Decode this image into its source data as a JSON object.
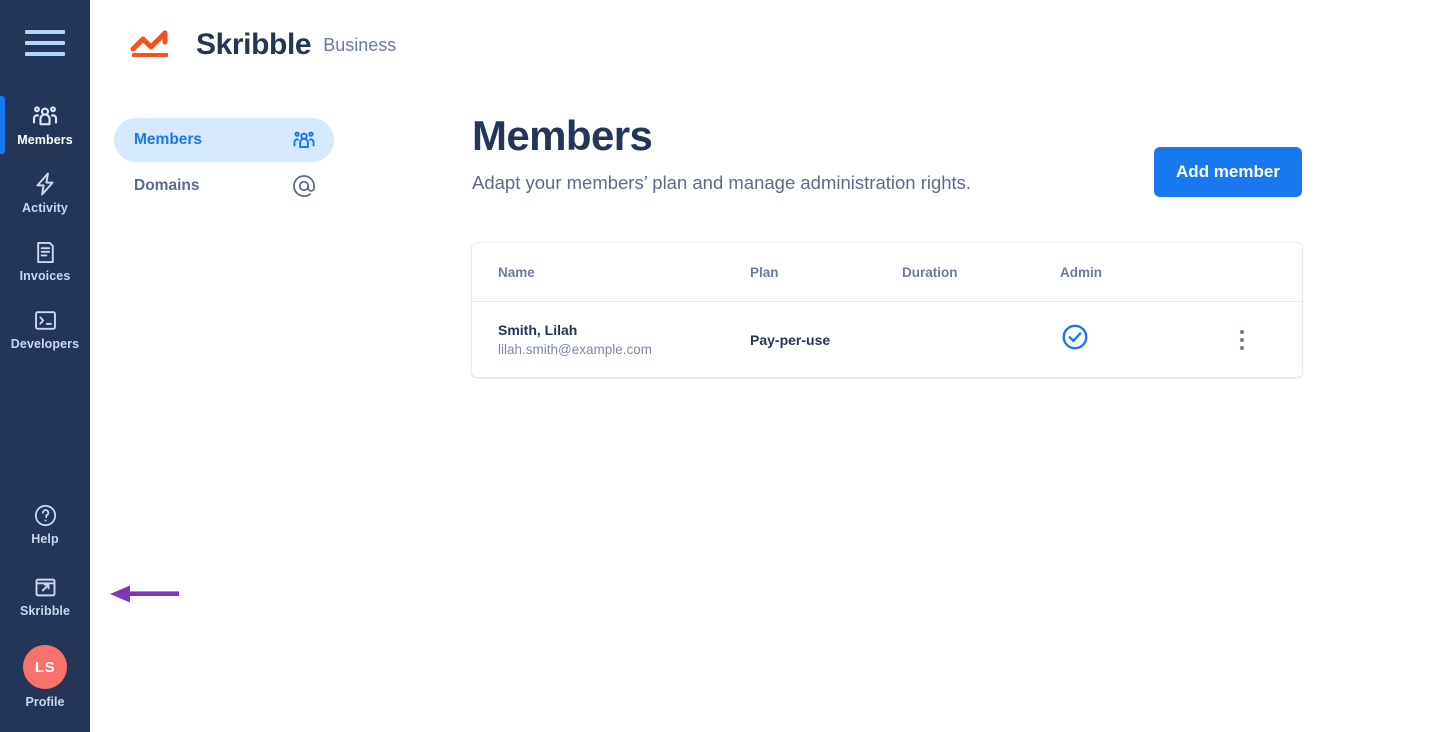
{
  "sidebar": {
    "menu_icon": "hamburger-icon",
    "items": [
      {
        "label": "Members",
        "icon": "people-group-icon",
        "active": true
      },
      {
        "label": "Activity",
        "icon": "lightning-bolt-icon",
        "active": false
      },
      {
        "label": "Invoices",
        "icon": "document-lines-icon",
        "active": false
      },
      {
        "label": "Developers",
        "icon": "terminal-icon",
        "active": false
      }
    ],
    "bottom_items": [
      {
        "label": "Help",
        "icon": "question-circle-icon"
      },
      {
        "label": "Skribble",
        "icon": "external-link-icon"
      }
    ],
    "profile": {
      "initials": "LS",
      "label": "Profile",
      "avatar_color": "#f9716a"
    },
    "active_indicator_color": "#1878f0",
    "background_color": "#243657"
  },
  "annotation": {
    "type": "arrow-left",
    "color": "#7b38b8"
  },
  "logo": {
    "name": "Skribble",
    "suffix": "Business",
    "mark_color": "#f4511e"
  },
  "tabs": [
    {
      "label": "Members",
      "icon": "people-group-icon",
      "active": true
    },
    {
      "label": "Domains",
      "icon": "at-sign-icon",
      "active": false
    }
  ],
  "main": {
    "title": "Members",
    "subtitle": "Adapt your members’ plan and manage administration rights.",
    "add_button_label": "Add member",
    "accent_color": "#1878f0"
  },
  "table": {
    "columns": [
      "Name",
      "Plan",
      "Duration",
      "Admin"
    ],
    "rows": [
      {
        "name": "Smith, Lilah",
        "email": "lilah.smith@example.com",
        "plan": "Pay-per-use",
        "duration": "",
        "admin": true,
        "admin_icon": "check-circle-icon",
        "menu_icon": "kebab-menu-icon"
      }
    ]
  }
}
